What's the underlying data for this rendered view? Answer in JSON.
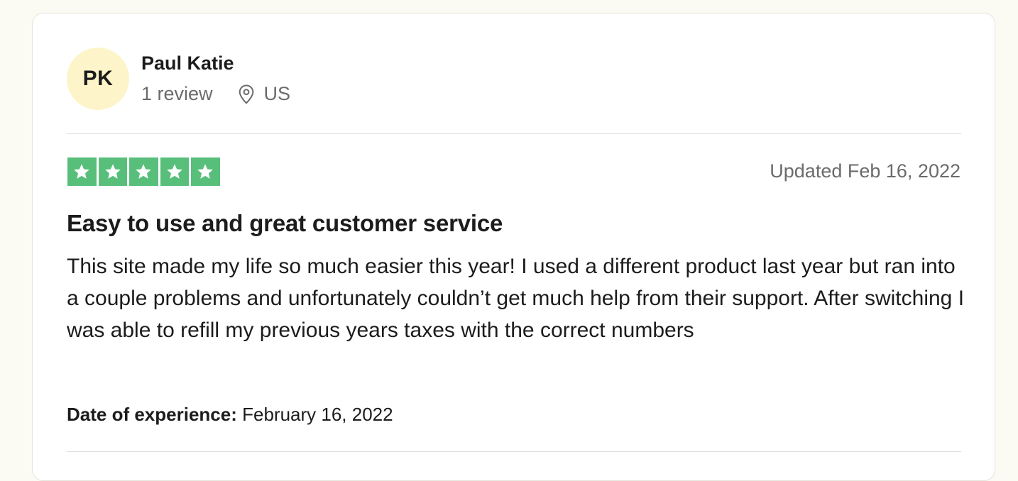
{
  "consumer": {
    "initials": "PK",
    "name": "Paul Katie",
    "review_count": "1 review",
    "country": "US"
  },
  "review": {
    "rating": 5,
    "rating_max": 5,
    "star_color": "#58bf7b",
    "date_label": "Updated Feb 16, 2022",
    "title": "Easy to use and great customer service",
    "body": "This site made my life so much easier this year! I used a different product last year but ran into a couple problems and unfortunately couldn’t get much help from their support. After switching I was able to refill my previous years taxes with the correct numbers",
    "experience_label": "Date of experience:",
    "experience_date": "February 16, 2022"
  },
  "icons": {
    "location": "location-pin-icon",
    "star": "star-icon"
  }
}
